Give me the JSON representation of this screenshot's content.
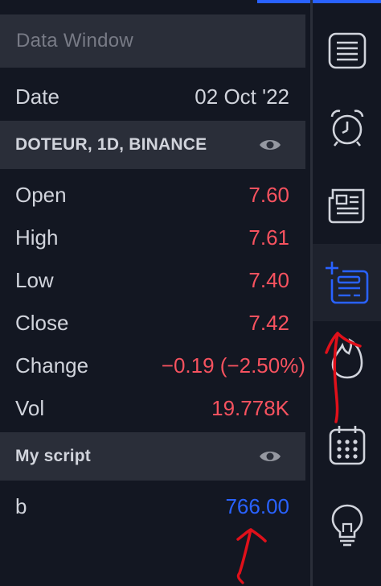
{
  "data_window": {
    "title": "Data Window",
    "date_label": "Date",
    "date_value": "02 Oct '22",
    "symbol_section": {
      "title": "DOTEUR, 1D, BINANCE",
      "rows": [
        {
          "label": "Open",
          "value": "7.60"
        },
        {
          "label": "High",
          "value": "7.61"
        },
        {
          "label": "Low",
          "value": "7.40"
        },
        {
          "label": "Close",
          "value": "7.42"
        },
        {
          "label": "Change",
          "value": "−0.19 (−2.50%)"
        },
        {
          "label": "Vol",
          "value": "19.778K"
        }
      ]
    },
    "script_section": {
      "title": "My script",
      "rows": [
        {
          "label": "b",
          "value": "766.00"
        }
      ]
    }
  },
  "sidebar": {
    "items": [
      {
        "icon": "watchlist-icon"
      },
      {
        "icon": "alarm-clock-icon"
      },
      {
        "icon": "news-icon"
      },
      {
        "icon": "data-window-icon",
        "active": true
      },
      {
        "icon": "hotlist-flame-icon"
      },
      {
        "icon": "calendar-icon"
      },
      {
        "icon": "ideas-lightbulb-icon"
      }
    ]
  },
  "colors": {
    "background": "#131722",
    "panel_header": "#2a2e39",
    "text": "#d1d4dc",
    "muted_text": "#787b86",
    "negative": "#f7525f",
    "accent_blue": "#2962ff",
    "annotation_red": "#e0101a"
  }
}
